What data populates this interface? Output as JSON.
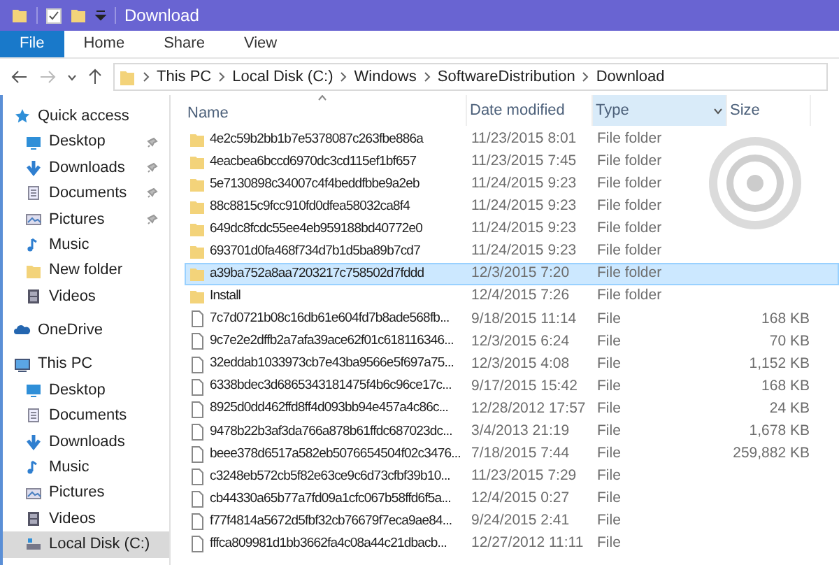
{
  "window": {
    "title": "Download"
  },
  "ribbon_tabs": [
    {
      "label": "File",
      "selected": true
    },
    {
      "label": "Home",
      "selected": false
    },
    {
      "label": "Share",
      "selected": false
    },
    {
      "label": "View",
      "selected": false
    }
  ],
  "address_bar": {
    "path": [
      "This PC",
      "Local Disk (C:)",
      "Windows",
      "SoftwareDistribution",
      "Download"
    ]
  },
  "navigation": [
    {
      "label": "Quick access",
      "kind": "quick",
      "children": [
        {
          "label": "Desktop",
          "kind": "desktop",
          "pinned": true,
          "selected": false
        },
        {
          "label": "Downloads",
          "kind": "downloads",
          "pinned": true,
          "selected": false
        },
        {
          "label": "Documents",
          "kind": "documents",
          "pinned": true,
          "selected": false
        },
        {
          "label": "Pictures",
          "kind": "pictures",
          "pinned": true,
          "selected": false
        },
        {
          "label": "Music",
          "kind": "music",
          "pinned": false,
          "selected": false
        },
        {
          "label": "New folder",
          "kind": "folder",
          "pinned": false,
          "selected": false
        },
        {
          "label": "Videos",
          "kind": "videos",
          "pinned": false,
          "selected": false
        }
      ]
    },
    {
      "label": "OneDrive",
      "kind": "cloud"
    },
    {
      "label": "This PC",
      "kind": "pc",
      "children": [
        {
          "label": "Desktop",
          "kind": "desktop",
          "pinned": false,
          "selected": false
        },
        {
          "label": "Documents",
          "kind": "documents",
          "pinned": false,
          "selected": false
        },
        {
          "label": "Downloads",
          "kind": "downloads",
          "pinned": false,
          "selected": false
        },
        {
          "label": "Music",
          "kind": "music",
          "pinned": false,
          "selected": false
        },
        {
          "label": "Pictures",
          "kind": "pictures",
          "pinned": false,
          "selected": false
        },
        {
          "label": "Videos",
          "kind": "videos",
          "pinned": false,
          "selected": false
        },
        {
          "label": "Local Disk (C:)",
          "kind": "disk",
          "pinned": false,
          "selected": true
        }
      ]
    }
  ],
  "table": {
    "columns": [
      {
        "label": "Name",
        "sorted": true,
        "hovered": false
      },
      {
        "label": "Date modified",
        "sorted": false,
        "hovered": false
      },
      {
        "label": "Type",
        "sorted": false,
        "hovered": true
      },
      {
        "label": "Size",
        "sorted": false,
        "hovered": false
      }
    ],
    "rows": [
      {
        "kind": "folder",
        "name": "4e2c59b2bb1b7e5378087c263fbe886a",
        "date": "11/23/2015 8:01",
        "type": "File folder",
        "selected": false
      },
      {
        "kind": "folder",
        "name": "4eacbea6bccd6970dc3cd115ef1bf657",
        "date": "11/23/2015 7:45",
        "type": "File folder",
        "selected": false
      },
      {
        "kind": "folder",
        "name": "5e7130898c34007c4f4beddfbbe9a2eb",
        "date": "11/24/2015 9:23",
        "type": "File folder",
        "selected": false
      },
      {
        "kind": "folder",
        "name": "88c8815c9fcc910fd0dfea58032ca8f4",
        "date": "11/24/2015 9:23",
        "type": "File folder",
        "selected": false
      },
      {
        "kind": "folder",
        "name": "649dc8fcdc55ee4eb959188bd40772e0",
        "date": "11/24/2015 9:23",
        "type": "File folder",
        "selected": false
      },
      {
        "kind": "folder",
        "name": "693701d0fa468f734d7b1d5ba89b7cd7",
        "date": "11/24/2015 9:23",
        "type": "File folder",
        "selected": false
      },
      {
        "kind": "folder",
        "name": "a39ba752a8aa7203217c758502d7fddd",
        "date": "12/3/2015 7:20",
        "type": "File folder",
        "selected": true
      },
      {
        "kind": "folder",
        "name": "Install",
        "date": "12/4/2015 7:26",
        "type": "File folder",
        "selected": false
      },
      {
        "kind": "file",
        "name": "7c7d0721b08c16db61e604fd7b8ade568fb...",
        "date": "9/18/2015 11:14",
        "type": "File",
        "size": "168 KB",
        "selected": false
      },
      {
        "kind": "file",
        "name": "9c7e2e2dffb2a7afa39ace62f01c618116346...",
        "date": "12/3/2015 6:24",
        "type": "File",
        "size": "70 KB",
        "selected": false
      },
      {
        "kind": "file",
        "name": "32eddab1033973cb7e43ba9566e5f697a75...",
        "date": "12/3/2015 4:08",
        "type": "File",
        "size": "1,152 KB",
        "selected": false
      },
      {
        "kind": "file",
        "name": "6338bdec3d6865343181475f4b6c96ce17c...",
        "date": "9/17/2015 15:42",
        "type": "File",
        "size": "168 KB",
        "selected": false
      },
      {
        "kind": "file",
        "name": "8925d0dd462ffd8ff4d093bb94e457a4c86c...",
        "date": "12/28/2012 17:57",
        "type": "File",
        "size": "24 KB",
        "selected": false
      },
      {
        "kind": "file",
        "name": "9478b22b3af3da766a878b61ffdc687023dc...",
        "date": "3/4/2013 21:19",
        "type": "File",
        "size": "1,678 KB",
        "selected": false
      },
      {
        "kind": "file",
        "name": "beee378d6517a582eb5076654504f02c3476...",
        "date": "7/18/2015 7:44",
        "type": "File",
        "size": "259,882 KB",
        "selected": false
      },
      {
        "kind": "file",
        "name": "c3248eb572cb5f82e63ce9c6d73cfbf39b10...",
        "date": "11/23/2015 7:29",
        "type": "File",
        "selected": false
      },
      {
        "kind": "file",
        "name": "cb44330a65b77a7fd09a1cfc067b58ffd6f5a...",
        "date": "12/4/2015 0:27",
        "type": "File",
        "selected": false
      },
      {
        "kind": "file",
        "name": "f77f4814a5672d5fbf32cb76679f7eca9ae84...",
        "date": "9/24/2015 2:41",
        "type": "File",
        "selected": false
      },
      {
        "kind": "file",
        "name": "fffca809981d1bb3662fa4c08a44c21dbacb...",
        "date": "12/27/2012 11:11",
        "type": "File",
        "selected": false
      }
    ]
  },
  "busy": true
}
